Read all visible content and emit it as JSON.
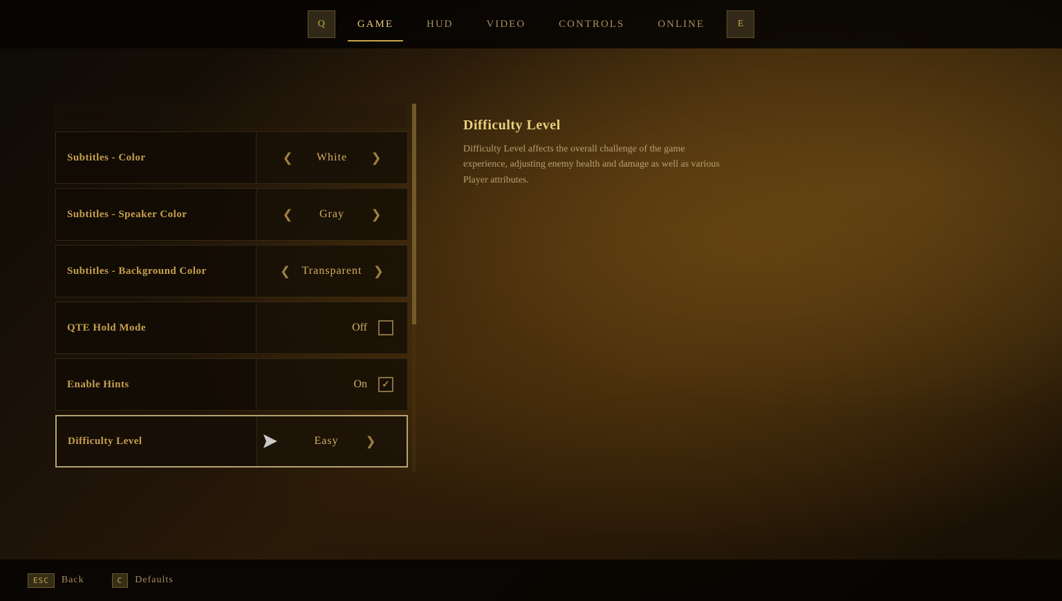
{
  "nav": {
    "tabs": [
      {
        "id": "game",
        "label": "GAME",
        "active": true
      },
      {
        "id": "hud",
        "label": "HUD",
        "active": false
      },
      {
        "id": "video",
        "label": "VIDEO",
        "active": false
      },
      {
        "id": "controls",
        "label": "CONTROLS",
        "active": false
      },
      {
        "id": "online",
        "label": "ONLINE",
        "active": false
      }
    ],
    "left_icon": "Q",
    "right_icon": "E"
  },
  "settings": {
    "rows": [
      {
        "id": "subtitles-color",
        "label": "Subtitles - Color",
        "type": "select",
        "value": "White",
        "selected": false
      },
      {
        "id": "subtitles-speaker-color",
        "label": "Subtitles - Speaker Color",
        "type": "select",
        "value": "Gray",
        "selected": false
      },
      {
        "id": "subtitles-bg-color",
        "label": "Subtitles - Background Color",
        "type": "select",
        "value": "Transparent",
        "selected": false
      },
      {
        "id": "qte-hold-mode",
        "label": "QTE Hold Mode",
        "type": "checkbox",
        "value": "Off",
        "checked": false,
        "selected": false
      },
      {
        "id": "enable-hints",
        "label": "Enable Hints",
        "type": "checkbox",
        "value": "On",
        "checked": true,
        "selected": false
      },
      {
        "id": "difficulty-level",
        "label": "Difficulty Level",
        "type": "select",
        "value": "Easy",
        "selected": true
      }
    ]
  },
  "info": {
    "title": "Difficulty Level",
    "description": "Difficulty Level affects the overall challenge of the game experience, adjusting enemy health and damage as well as various Player attributes."
  },
  "bottom": {
    "actions": [
      {
        "key": "ESC",
        "label": "Back"
      },
      {
        "key": "C",
        "label": "Defaults"
      }
    ]
  }
}
